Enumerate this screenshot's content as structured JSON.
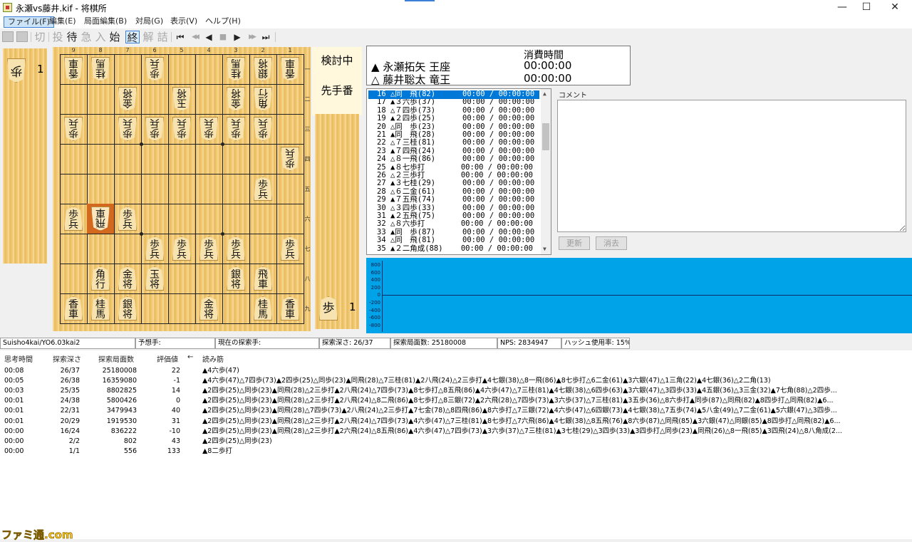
{
  "window": {
    "title": "永瀬vs藤井.kif - 将棋所",
    "buttons": {
      "minimize": "—",
      "maximize": "☐",
      "close": "✕"
    }
  },
  "menu": [
    {
      "label": "ファイル(F)",
      "active": true
    },
    {
      "label": "編集(E)"
    },
    {
      "label": "局面編集(B)"
    },
    {
      "label": "対局(G)"
    },
    {
      "label": "表示(V)"
    },
    {
      "label": "ヘルプ(H)"
    }
  ],
  "toolbar": {
    "buttons": [
      {
        "label": "切",
        "enabled": false
      },
      {
        "label": "投",
        "enabled": false
      },
      {
        "label": "待",
        "enabled": true
      },
      {
        "label": "急",
        "enabled": false
      },
      {
        "label": "入",
        "enabled": false
      },
      {
        "label": "始",
        "enabled": true
      },
      {
        "label": "終",
        "enabled": true,
        "boxed": true
      },
      {
        "label": "解",
        "enabled": false
      },
      {
        "label": "詰",
        "enabled": false
      }
    ],
    "nav": [
      "⏮",
      "◀◀",
      "◀",
      "■",
      "▶",
      "▶▶",
      "⏭"
    ]
  },
  "board": {
    "files": [
      "9",
      "8",
      "7",
      "6",
      "5",
      "4",
      "3",
      "2",
      "1"
    ],
    "ranks": [
      "一",
      "二",
      "三",
      "四",
      "五",
      "六",
      "七",
      "八",
      "九"
    ],
    "pieces": [
      {
        "file": 9,
        "rank": 1,
        "t1": "香",
        "t2": "車",
        "side": "gote"
      },
      {
        "file": 8,
        "rank": 1,
        "t1": "桂",
        "t2": "馬",
        "side": "gote"
      },
      {
        "file": 6,
        "rank": 1,
        "t1": "歩",
        "t2": "兵",
        "side": "gote"
      },
      {
        "file": 3,
        "rank": 1,
        "t1": "桂",
        "t2": "馬",
        "side": "gote"
      },
      {
        "file": 2,
        "rank": 1,
        "t1": "銀",
        "t2": "将",
        "side": "gote"
      },
      {
        "file": 1,
        "rank": 1,
        "t1": "香",
        "t2": "車",
        "side": "gote"
      },
      {
        "file": 7,
        "rank": 2,
        "t1": "金",
        "t2": "将",
        "side": "gote"
      },
      {
        "file": 5,
        "rank": 2,
        "t1": "玉",
        "t2": "将",
        "side": "gote"
      },
      {
        "file": 3,
        "rank": 2,
        "t1": "金",
        "t2": "将",
        "side": "gote"
      },
      {
        "file": 2,
        "rank": 2,
        "t1": "角",
        "t2": "行",
        "side": "gote"
      },
      {
        "file": 9,
        "rank": 3,
        "t1": "歩",
        "t2": "兵",
        "side": "gote"
      },
      {
        "file": 7,
        "rank": 3,
        "t1": "歩",
        "t2": "兵",
        "side": "gote"
      },
      {
        "file": 6,
        "rank": 3,
        "t1": "歩",
        "t2": "兵",
        "side": "gote"
      },
      {
        "file": 5,
        "rank": 3,
        "t1": "歩",
        "t2": "兵",
        "side": "gote"
      },
      {
        "file": 4,
        "rank": 3,
        "t1": "歩",
        "t2": "兵",
        "side": "gote"
      },
      {
        "file": 3,
        "rank": 3,
        "t1": "歩",
        "t2": "兵",
        "side": "gote"
      },
      {
        "file": 2,
        "rank": 3,
        "t1": "歩",
        "t2": "兵",
        "side": "gote"
      },
      {
        "file": 1,
        "rank": 4,
        "t1": "歩",
        "t2": "兵",
        "side": "gote"
      },
      {
        "file": 2,
        "rank": 5,
        "t1": "歩",
        "t2": "兵",
        "side": "sente"
      },
      {
        "file": 9,
        "rank": 6,
        "t1": "歩",
        "t2": "兵",
        "side": "sente"
      },
      {
        "file": 8,
        "rank": 6,
        "t1": "飛",
        "t2": "車",
        "side": "gote",
        "last": true
      },
      {
        "file": 7,
        "rank": 6,
        "t1": "歩",
        "t2": "兵",
        "side": "sente"
      },
      {
        "file": 6,
        "rank": 7,
        "t1": "歩",
        "t2": "兵",
        "side": "sente"
      },
      {
        "file": 5,
        "rank": 7,
        "t1": "歩",
        "t2": "兵",
        "side": "sente"
      },
      {
        "file": 4,
        "rank": 7,
        "t1": "歩",
        "t2": "兵",
        "side": "sente"
      },
      {
        "file": 3,
        "rank": 7,
        "t1": "歩",
        "t2": "兵",
        "side": "sente"
      },
      {
        "file": 1,
        "rank": 7,
        "t1": "歩",
        "t2": "兵",
        "side": "sente"
      },
      {
        "file": 8,
        "rank": 8,
        "t1": "角",
        "t2": "行",
        "side": "sente"
      },
      {
        "file": 7,
        "rank": 8,
        "t1": "金",
        "t2": "将",
        "side": "sente"
      },
      {
        "file": 6,
        "rank": 8,
        "t1": "玉",
        "t2": "将",
        "side": "sente"
      },
      {
        "file": 3,
        "rank": 8,
        "t1": "銀",
        "t2": "将",
        "side": "sente"
      },
      {
        "file": 2,
        "rank": 8,
        "t1": "飛",
        "t2": "車",
        "side": "sente"
      },
      {
        "file": 9,
        "rank": 9,
        "t1": "香",
        "t2": "車",
        "side": "sente"
      },
      {
        "file": 8,
        "rank": 9,
        "t1": "桂",
        "t2": "馬",
        "side": "sente"
      },
      {
        "file": 7,
        "rank": 9,
        "t1": "銀",
        "t2": "将",
        "side": "sente"
      },
      {
        "file": 4,
        "rank": 9,
        "t1": "金",
        "t2": "将",
        "side": "sente"
      },
      {
        "file": 2,
        "rank": 9,
        "t1": "桂",
        "t2": "馬",
        "side": "sente"
      },
      {
        "file": 1,
        "rank": 9,
        "t1": "香",
        "t2": "車",
        "side": "sente"
      }
    ],
    "gote_hand": {
      "piece": "歩",
      "count": "1"
    },
    "sente_hand": {
      "piece": "歩",
      "count": "1"
    },
    "status1": "検討中",
    "status2": "先手番",
    "last_move_color": "#d2691e"
  },
  "players": {
    "time_header": "消費時間",
    "sente": {
      "mark": "▲",
      "name": "永瀬拓矢 王座",
      "time": "00:00:00"
    },
    "gote": {
      "mark": "△",
      "name": "藤井聡太 竜王",
      "time": "00:00:00"
    }
  },
  "moves": [
    {
      "text": "16 △同　飛(82)      00:00 / 00:00:00",
      "selected": true
    },
    {
      "text": "17 ▲３六歩(37)      00:00 / 00:00:00"
    },
    {
      "text": "18 △７四歩(73)      00:00 / 00:00:00"
    },
    {
      "text": "19 ▲２四歩(25)      00:00 / 00:00:00"
    },
    {
      "text": "20 △同　歩(23)      00:00 / 00:00:00"
    },
    {
      "text": "21 ▲同　飛(28)      00:00 / 00:00:00"
    },
    {
      "text": "22 △７三桂(81)      00:00 / 00:00:00"
    },
    {
      "text": "23 ▲７四飛(24)      00:00 / 00:00:00"
    },
    {
      "text": "24 △８一飛(86)      00:00 / 00:00:00"
    },
    {
      "text": "25 ▲８七歩打        00:00 / 00:00:00"
    },
    {
      "text": "26 △２三歩打        00:00 / 00:00:00"
    },
    {
      "text": "27 ▲３七桂(29)      00:00 / 00:00:00"
    },
    {
      "text": "28 △６二金(61)      00:00 / 00:00:00"
    },
    {
      "text": "29 ▲７五飛(74)      00:00 / 00:00:00"
    },
    {
      "text": "30 △３四歩(33)      00:00 / 00:00:00"
    },
    {
      "text": "31 ▲２五飛(75)      00:00 / 00:00:00"
    },
    {
      "text": "32 △８六歩打        00:00 / 00:00:00"
    },
    {
      "text": "33 ▲同　歩(87)      00:00 / 00:00:00"
    },
    {
      "text": "34 △同　飛(81)      00:00 / 00:00:00"
    },
    {
      "text": "35 ▲２二角成(88)    00:00 / 00:00:00"
    }
  ],
  "comment": {
    "label": "コメント",
    "value": ""
  },
  "buttons": {
    "update": "更新",
    "clear": "消去"
  },
  "graph": {
    "ticks": [
      "800",
      "600",
      "400",
      "200",
      "0",
      "-200",
      "-400",
      "-600",
      "-800"
    ],
    "background": "#00a2e8"
  },
  "status": {
    "engine": "Suisho4kai/YO6.03kai2",
    "predicted": "予想手:",
    "current": "現在の探索手:",
    "depth": "探索深さ: 26/37",
    "nodes": "探索局面数: 25180008",
    "nps": "NPS: 2834947",
    "hash": "ハッシュ使用率: 15%"
  },
  "pv": {
    "headers": {
      "time": "思考時間",
      "depth": "探索深さ",
      "nodes": "探索局面数",
      "eval": "評価値",
      "arrow": "←",
      "line": "読み筋"
    },
    "rows": [
      {
        "time": "00:08",
        "depth": "26/37",
        "nodes": "25180008",
        "eval": "22",
        "line": "▲4六歩(47)"
      },
      {
        "time": "00:05",
        "depth": "26/38",
        "nodes": "16359080",
        "eval": "-1",
        "line": "▲4六歩(47)△7四歩(73)▲2四歩(25)△同歩(23)▲同飛(28)△7三桂(81)▲2八飛(24)△2三歩打▲4七銀(38)△8一飛(86)▲8七歩打△6二金(61)▲3六銀(47)△1三角(22)▲4七銀(36)△2二角(13)"
      },
      {
        "time": "00:03",
        "depth": "25/35",
        "nodes": "8802825",
        "eval": "14",
        "line": "▲2四歩(25)△同歩(23)▲同飛(28)△2三歩打▲2八飛(24)△7四歩(73)▲8七歩打△8五飛(86)▲4六歩(47)△7三桂(81)▲4七銀(38)△6四歩(63)▲3六銀(47)△3四歩(33)▲4五銀(36)△3三金(32)▲7七角(88)△2四歩..."
      },
      {
        "time": "00:01",
        "depth": "24/38",
        "nodes": "5800426",
        "eval": "0",
        "line": "▲2四歩(25)△同歩(23)▲同飛(28)△2三歩打▲2八飛(24)△8二飛(86)▲8七歩打△8三銀(72)▲2六飛(28)△7四歩(73)▲3六歩(37)△7三桂(81)▲3五歩(36)△8六歩打▲同歩(87)△同飛(82)▲8四歩打△同飛(82)▲6..."
      },
      {
        "time": "00:01",
        "depth": "22/31",
        "nodes": "3479943",
        "eval": "40",
        "line": "▲2四歩(25)△同歩(23)▲同飛(28)△7四歩(73)▲2八飛(24)△2三歩打▲7七金(78)△8四飛(86)▲8六歩打△7三銀(72)▲4六歩(47)△6四銀(73)▲4七銀(38)△7五歩(74)▲5八金(49)△7二金(61)▲5六銀(47)△3四歩..."
      },
      {
        "time": "00:01",
        "depth": "20/29",
        "nodes": "1919530",
        "eval": "31",
        "line": "▲2四歩(25)△同歩(23)▲同飛(28)△2三歩打▲2八飛(24)△7四歩(73)▲4六歩(47)△7三桂(81)▲8七歩打△7六飛(86)▲4七銀(38)△8五飛(76)▲8六歩(87)△同飛(85)▲3六銀(47)△同銀(85)▲8四歩打△同飛(82)▲6..."
      },
      {
        "time": "00:00",
        "depth": "16/24",
        "nodes": "836222",
        "eval": "-10",
        "line": "▲2四歩(25)△同歩(23)▲同飛(28)△2三歩打▲2六飛(24)△8五飛(86)▲4六歩(47)△7四歩(73)▲3六歩(37)△7三桂(81)▲3七桂(29)△3四歩(33)▲3四歩打△同歩(23)▲同飛(26)△8一飛(85)▲3四飛(24)△8八角成(2..."
      },
      {
        "time": "00:00",
        "depth": "2/2",
        "nodes": "802",
        "eval": "43",
        "line": "▲2四歩(25)△同歩(23)"
      },
      {
        "time": "00:00",
        "depth": "1/1",
        "nodes": "556",
        "eval": "133",
        "line": "▲8二歩打"
      }
    ]
  },
  "watermark": "ファミ通.com"
}
